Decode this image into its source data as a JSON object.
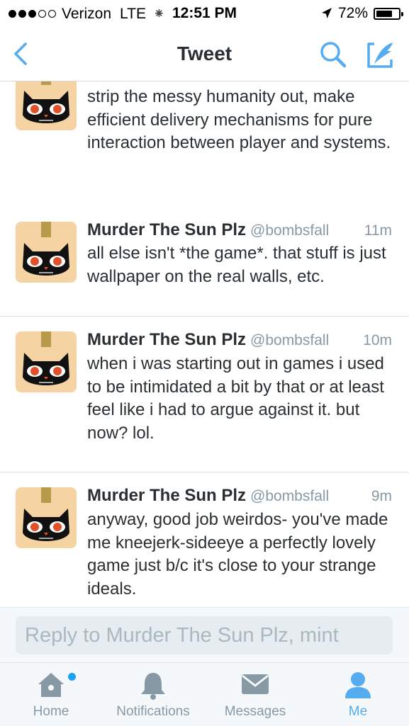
{
  "status_bar": {
    "carrier": "Verizon",
    "network": "LTE",
    "time": "12:51 PM",
    "battery": "72%",
    "battery_level": 0.72
  },
  "nav": {
    "title": "Tweet"
  },
  "tweets": [
    {
      "name": "",
      "handle": "",
      "time": "",
      "text": "strip the messy humanity out, make efficient delivery mechanisms for pure interaction between player and systems."
    },
    {
      "name": "Murder The Sun Plz",
      "handle": "@bombsfall",
      "time": "11m",
      "text": "all else isn't *the game*. that stuff is just wallpaper on the real walls, etc."
    },
    {
      "name": "Murder The Sun Plz",
      "handle": "@bombsfall",
      "time": "10m",
      "text": "when i was starting out in games i used to be intimidated a bit by that or at least feel like i had to argue against it. but now? lol."
    },
    {
      "name": "Murder The Sun Plz",
      "handle": "@bombsfall",
      "time": "9m",
      "text": "anyway, good job weirdos- you've made me kneejerk-sideeye a perfectly lovely game just b/c it's close to your strange ideals."
    }
  ],
  "reply": {
    "placeholder": "Reply to Murder The Sun Plz, mint"
  },
  "tabs": [
    {
      "label": "Home",
      "icon": "home-icon",
      "active": false
    },
    {
      "label": "Notifications",
      "icon": "bell-icon",
      "active": false
    },
    {
      "label": "Messages",
      "icon": "envelope-icon",
      "active": false
    },
    {
      "label": "Me",
      "icon": "person-icon",
      "active": true
    }
  ],
  "colors": {
    "accent": "#55acee",
    "text": "#292f33",
    "muted": "#8899a6"
  }
}
